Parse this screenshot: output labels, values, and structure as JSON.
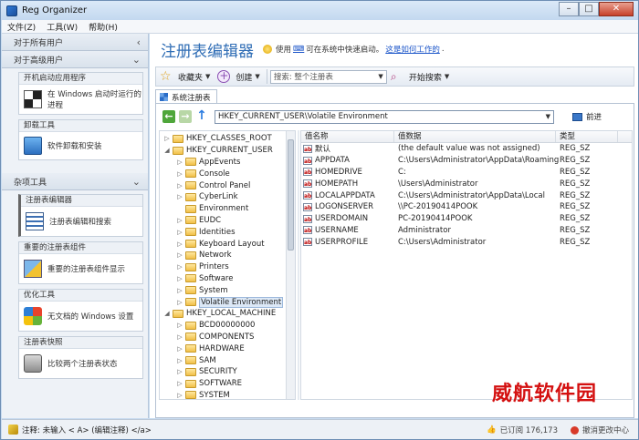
{
  "window": {
    "title": "Reg Organizer"
  },
  "menu": [
    "文件(Z)",
    "工具(W)",
    "帮助(H)"
  ],
  "sidebar": {
    "group_all_users": "对于所有用户",
    "group_advanced": "对于高级用户",
    "advanced_cards": [
      {
        "head": "开机启动应用程序",
        "body": "在 Windows 启动时运行的进程"
      },
      {
        "head": "卸载工具",
        "body": "软件卸载和安装"
      }
    ],
    "group_misc": "杂项工具",
    "misc_cards": [
      {
        "head": "注册表编辑器",
        "body": "注册表编辑和搜索"
      },
      {
        "head": "重要的注册表组件",
        "body": "重要的注册表组件显示"
      },
      {
        "head": "优化工具",
        "body": "无文档的 Windows 设置"
      },
      {
        "head": "注册表快照",
        "body": "比较两个注册表状态"
      }
    ]
  },
  "header": {
    "title": "注册表编辑器",
    "hint_before": "使用",
    "hint_key": "⌨",
    "hint_after": "可在系统中快速启动。",
    "hint_link": "这是如何工作的"
  },
  "toolbar": {
    "favorites": "收藏夹",
    "create": "创建",
    "search_placeholder": "搜索: 整个注册表",
    "start_search": "开始搜索"
  },
  "tab": {
    "label": "系统注册表"
  },
  "nav": {
    "path": "HKEY_CURRENT_USER\\Volatile Environment",
    "goto": "前进"
  },
  "tree": [
    {
      "label": "HKEY_CLASSES_ROOT",
      "level": 0,
      "expander": "▷"
    },
    {
      "label": "HKEY_CURRENT_USER",
      "level": 0,
      "expander": "◢"
    },
    {
      "label": "AppEvents",
      "level": 1,
      "expander": "▷"
    },
    {
      "label": "Console",
      "level": 1,
      "expander": "▷"
    },
    {
      "label": "Control Panel",
      "level": 1,
      "expander": "▷"
    },
    {
      "label": "CyberLink",
      "level": 1,
      "expander": "▷"
    },
    {
      "label": "Environment",
      "level": 1,
      "expander": ""
    },
    {
      "label": "EUDC",
      "level": 1,
      "expander": "▷"
    },
    {
      "label": "Identities",
      "level": 1,
      "expander": "▷"
    },
    {
      "label": "Keyboard Layout",
      "level": 1,
      "expander": "▷"
    },
    {
      "label": "Network",
      "level": 1,
      "expander": "▷"
    },
    {
      "label": "Printers",
      "level": 1,
      "expander": "▷"
    },
    {
      "label": "Software",
      "level": 1,
      "expander": "▷"
    },
    {
      "label": "System",
      "level": 1,
      "expander": "▷"
    },
    {
      "label": "Volatile Environment",
      "level": 1,
      "expander": "▷",
      "selected": true
    },
    {
      "label": "HKEY_LOCAL_MACHINE",
      "level": 0,
      "expander": "◢"
    },
    {
      "label": "BCD00000000",
      "level": 1,
      "expander": "▷"
    },
    {
      "label": "COMPONENTS",
      "level": 1,
      "expander": "▷"
    },
    {
      "label": "HARDWARE",
      "level": 1,
      "expander": "▷"
    },
    {
      "label": "SAM",
      "level": 1,
      "expander": "▷"
    },
    {
      "label": "SECURITY",
      "level": 1,
      "expander": "▷"
    },
    {
      "label": "SOFTWARE",
      "level": 1,
      "expander": "▷"
    },
    {
      "label": "SYSTEM",
      "level": 1,
      "expander": "▷"
    }
  ],
  "values": {
    "columns": [
      "值名称",
      "值数据",
      "类型"
    ],
    "rows": [
      {
        "name": "默认",
        "data": "(the default value was not assigned)",
        "type": "REG_SZ"
      },
      {
        "name": "APPDATA",
        "data": "C:\\Users\\Administrator\\AppData\\Roaming",
        "type": "REG_SZ"
      },
      {
        "name": "HOMEDRIVE",
        "data": "C:",
        "type": "REG_SZ"
      },
      {
        "name": "HOMEPATH",
        "data": "\\Users\\Administrator",
        "type": "REG_SZ"
      },
      {
        "name": "LOCALAPPDATA",
        "data": "C:\\Users\\Administrator\\AppData\\Local",
        "type": "REG_SZ"
      },
      {
        "name": "LOGONSERVER",
        "data": "\\\\PC-20190414POOK",
        "type": "REG_SZ"
      },
      {
        "name": "USERDOMAIN",
        "data": "PC-20190414POOK",
        "type": "REG_SZ"
      },
      {
        "name": "USERNAME",
        "data": "Administrator",
        "type": "REG_SZ"
      },
      {
        "name": "USERPROFILE",
        "data": "C:\\Users\\Administrator",
        "type": "REG_SZ"
      }
    ]
  },
  "watermark": "威航软件园",
  "status": {
    "note": "注释: 未输入 < A> (编辑注释) </a>",
    "like_icon": "👍",
    "recommend": "已订阅 176,173",
    "undo": "撤消更改中心"
  }
}
